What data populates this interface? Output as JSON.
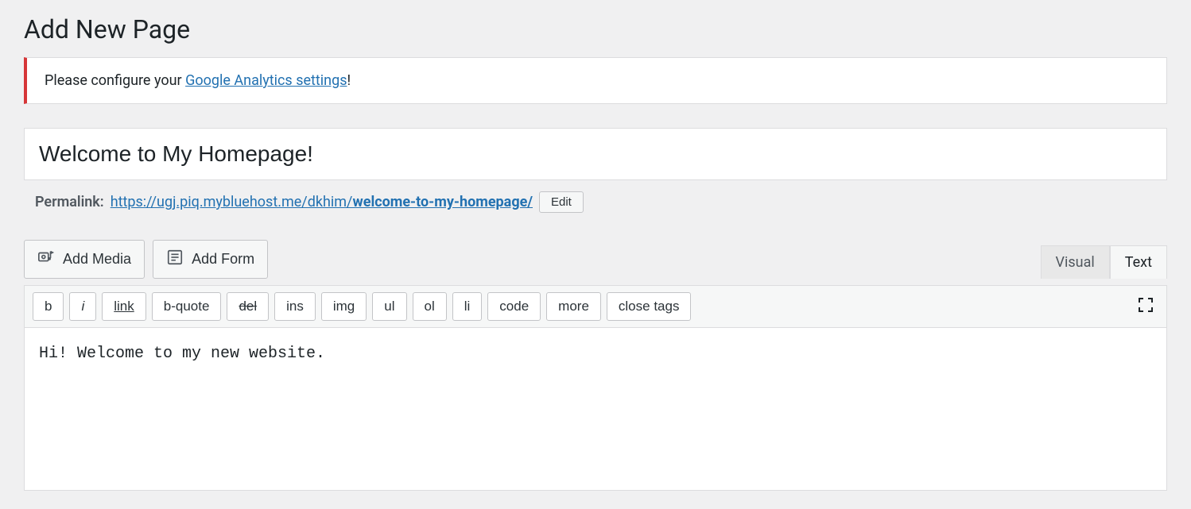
{
  "header": {
    "title": "Add New Page"
  },
  "notice": {
    "prefix": "Please configure your ",
    "link_text": "Google Analytics settings",
    "suffix": "!"
  },
  "title_input": {
    "value": "Welcome to My Homepage!"
  },
  "permalink": {
    "label": "Permalink:",
    "url_base": "https://ugj.piq.mybluehost.me/dkhim/",
    "slug": "welcome-to-my-homepage/",
    "edit_label": "Edit"
  },
  "media": {
    "add_media_label": "Add Media",
    "add_form_label": "Add Form"
  },
  "tabs": {
    "visual": "Visual",
    "text": "Text",
    "active": "text"
  },
  "quicktags": {
    "b": "b",
    "i": "i",
    "link": "link",
    "b_quote": "b-quote",
    "del": "del",
    "ins": "ins",
    "img": "img",
    "ul": "ul",
    "ol": "ol",
    "li": "li",
    "code": "code",
    "more": "more",
    "close_tags": "close tags"
  },
  "content": {
    "text": "Hi! Welcome to my new website."
  }
}
